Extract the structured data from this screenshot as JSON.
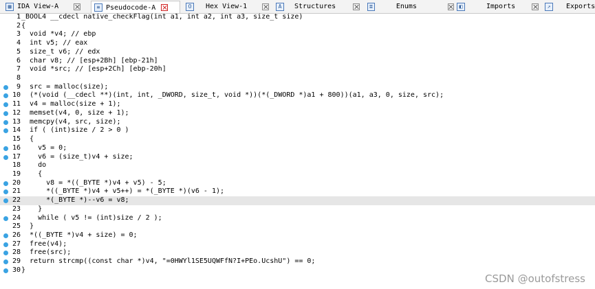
{
  "tabs": [
    {
      "label": "IDA View-A",
      "icon": "graph-view-icon",
      "active": false
    },
    {
      "label": "Pseudocode-A",
      "icon": "pseudocode-icon",
      "active": true
    },
    {
      "label": "Hex View-1",
      "icon": "hex-view-icon",
      "active": false
    },
    {
      "label": "Structures",
      "icon": "structures-icon",
      "active": false
    },
    {
      "label": "Enums",
      "icon": "enums-icon",
      "active": false
    },
    {
      "label": "Imports",
      "icon": "imports-icon",
      "active": false
    },
    {
      "label": "Exports",
      "icon": "exports-icon",
      "active": false
    }
  ],
  "code": {
    "lines": [
      {
        "num": "1",
        "text": "_BOOL4 __cdecl native_checkFlag(int a1, int a2, int a3, size_t size)",
        "bp": false
      },
      {
        "num": "2",
        "text": "{",
        "bp": false
      },
      {
        "num": "3",
        "text": "  void *v4; // ebp",
        "bp": false
      },
      {
        "num": "4",
        "text": "  int v5; // eax",
        "bp": false
      },
      {
        "num": "5",
        "text": "  size_t v6; // edx",
        "bp": false
      },
      {
        "num": "6",
        "text": "  char v8; // [esp+2Bh] [ebp-21h]",
        "bp": false
      },
      {
        "num": "7",
        "text": "  void *src; // [esp+2Ch] [ebp-20h]",
        "bp": false
      },
      {
        "num": "8",
        "text": "",
        "bp": false
      },
      {
        "num": "9",
        "text": "  src = malloc(size);",
        "bp": true
      },
      {
        "num": "10",
        "text": "  (*(void (__cdecl **)(int, int, _DWORD, size_t, void *))(*(_DWORD *)a1 + 800))(a1, a3, 0, size, src);",
        "bp": true
      },
      {
        "num": "11",
        "text": "  v4 = malloc(size + 1);",
        "bp": true
      },
      {
        "num": "12",
        "text": "  memset(v4, 0, size + 1);",
        "bp": true
      },
      {
        "num": "13",
        "text": "  memcpy(v4, src, size);",
        "bp": true
      },
      {
        "num": "14",
        "text": "  if ( (int)size / 2 > 0 )",
        "bp": true
      },
      {
        "num": "15",
        "text": "  {",
        "bp": false
      },
      {
        "num": "16",
        "text": "    v5 = 0;",
        "bp": true
      },
      {
        "num": "17",
        "text": "    v6 = (size_t)v4 + size;",
        "bp": true
      },
      {
        "num": "18",
        "text": "    do",
        "bp": false
      },
      {
        "num": "19",
        "text": "    {",
        "bp": false
      },
      {
        "num": "20",
        "text": "      v8 = *((_BYTE *)v4 + v5) - 5;",
        "bp": true
      },
      {
        "num": "21",
        "text": "      *((_BYTE *)v4 + v5++) = *(_BYTE *)(v6 - 1);",
        "bp": true
      },
      {
        "num": "22",
        "text": "      *(_BYTE *)--v6 = v8;",
        "bp": true,
        "highlight": true
      },
      {
        "num": "23",
        "text": "    }",
        "bp": false
      },
      {
        "num": "24",
        "text": "    while ( v5 != (int)size / 2 );",
        "bp": true
      },
      {
        "num": "25",
        "text": "  }",
        "bp": false
      },
      {
        "num": "26",
        "text": "  *((_BYTE *)v4 + size) = 0;",
        "bp": true
      },
      {
        "num": "27",
        "text": "  free(v4);",
        "bp": true
      },
      {
        "num": "28",
        "text": "  free(src);",
        "bp": true
      },
      {
        "num": "29",
        "text": "  return strcmp((const char *)v4, \"=0HWYl1SE5UQWFfN?I+PEo.UcshU\") == 0;",
        "bp": true
      },
      {
        "num": "30",
        "text": "}",
        "bp": true
      }
    ]
  },
  "watermark": "CSDN @outofstress",
  "colors": {
    "breakpoint": "#3aa3e3",
    "highlight": "#e6e6e6",
    "tabbar": "#f3f3f3"
  }
}
